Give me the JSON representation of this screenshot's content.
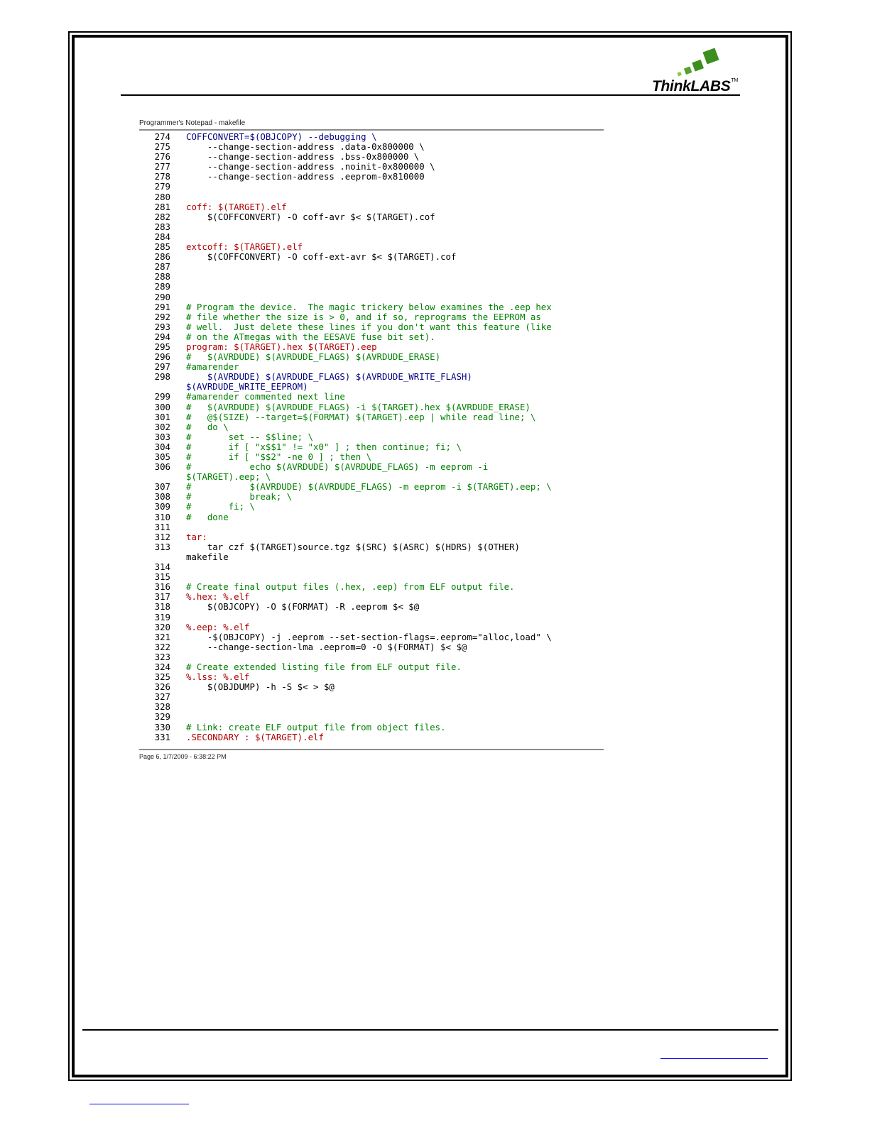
{
  "header": {
    "logo_text": "ThinkLABS",
    "logo_tm": "TM",
    "logo_colors": [
      "#8cc63f",
      "#5aa02c",
      "#3c8f1e"
    ]
  },
  "notepad": {
    "title": "Programmer's Notepad - makefile",
    "footer": "Page 6, 1/7/2009 - 6:38:22 PM"
  },
  "code_lines": [
    {
      "n": "274",
      "t": "COFFCONVERT=$(OBJCOPY) --debugging \\",
      "k": "var"
    },
    {
      "n": "275",
      "t": "    --change-section-address .data-0x800000 \\",
      "k": ""
    },
    {
      "n": "276",
      "t": "    --change-section-address .bss-0x800000 \\",
      "k": ""
    },
    {
      "n": "277",
      "t": "    --change-section-address .noinit-0x800000 \\",
      "k": ""
    },
    {
      "n": "278",
      "t": "    --change-section-address .eeprom-0x810000",
      "k": ""
    },
    {
      "n": "279",
      "t": "",
      "k": ""
    },
    {
      "n": "280",
      "t": "",
      "k": ""
    },
    {
      "n": "281",
      "t": "coff: $(TARGET).elf",
      "k": "tgt"
    },
    {
      "n": "282",
      "t": "    $(COFFCONVERT) -O coff-avr $< $(TARGET).cof",
      "k": ""
    },
    {
      "n": "283",
      "t": "",
      "k": ""
    },
    {
      "n": "284",
      "t": "",
      "k": ""
    },
    {
      "n": "285",
      "t": "extcoff: $(TARGET).elf",
      "k": "tgt"
    },
    {
      "n": "286",
      "t": "    $(COFFCONVERT) -O coff-ext-avr $< $(TARGET).cof",
      "k": ""
    },
    {
      "n": "287",
      "t": "",
      "k": ""
    },
    {
      "n": "288",
      "t": "",
      "k": ""
    },
    {
      "n": "289",
      "t": "",
      "k": ""
    },
    {
      "n": "290",
      "t": "",
      "k": ""
    },
    {
      "n": "291",
      "t": "# Program the device.  The magic trickery below examines the .eep hex",
      "k": "cmt"
    },
    {
      "n": "292",
      "t": "# file whether the size is > 0, and if so, reprograms the EEPROM as",
      "k": "cmt"
    },
    {
      "n": "293",
      "t": "# well.  Just delete these lines if you don't want this feature (like",
      "k": "cmt"
    },
    {
      "n": "294",
      "t": "# on the ATmegas with the EESAVE fuse bit set).",
      "k": "cmt"
    },
    {
      "n": "295",
      "t": "program: $(TARGET).hex $(TARGET).eep",
      "k": "tgt"
    },
    {
      "n": "296",
      "t": "#   $(AVRDUDE) $(AVRDUDE_FLAGS) $(AVRDUDE_ERASE)",
      "k": "cmt"
    },
    {
      "n": "297",
      "t": "#amarender",
      "k": "cmt"
    },
    {
      "n": "298",
      "t": "    $(AVRDUDE) $(AVRDUDE_FLAGS) $(AVRDUDE_WRITE_FLASH)",
      "k": "var"
    },
    {
      "n": "",
      "t": "$(AVRDUDE_WRITE_EEPROM)",
      "k": "var"
    },
    {
      "n": "299",
      "t": "#amarender commented next line",
      "k": "cmt"
    },
    {
      "n": "300",
      "t": "#   $(AVRDUDE) $(AVRDUDE_FLAGS) -i $(TARGET).hex $(AVRDUDE_ERASE)",
      "k": "cmt"
    },
    {
      "n": "301",
      "t": "#   @$(SIZE) --target=$(FORMAT) $(TARGET).eep | while read line; \\",
      "k": "cmt"
    },
    {
      "n": "302",
      "t": "#   do \\",
      "k": "cmt"
    },
    {
      "n": "303",
      "t": "#       set -- $$line; \\",
      "k": "cmt"
    },
    {
      "n": "304",
      "t": "#       if [ \"x$$1\" != \"x0\" ] ; then continue; fi; \\",
      "k": "cmt"
    },
    {
      "n": "305",
      "t": "#       if [ \"$$2\" -ne 0 ] ; then \\",
      "k": "cmt"
    },
    {
      "n": "306",
      "t": "#           echo $(AVRDUDE) $(AVRDUDE_FLAGS) -m eeprom -i",
      "k": "cmt"
    },
    {
      "n": "",
      "t": "$(TARGET).eep; \\",
      "k": "cmt"
    },
    {
      "n": "307",
      "t": "#           $(AVRDUDE) $(AVRDUDE_FLAGS) -m eeprom -i $(TARGET).eep; \\",
      "k": "cmt"
    },
    {
      "n": "308",
      "t": "#           break; \\",
      "k": "cmt"
    },
    {
      "n": "309",
      "t": "#       fi; \\",
      "k": "cmt"
    },
    {
      "n": "310",
      "t": "#   done",
      "k": "cmt"
    },
    {
      "n": "311",
      "t": "",
      "k": ""
    },
    {
      "n": "312",
      "t": "tar:",
      "k": "tgt"
    },
    {
      "n": "313",
      "t": "    tar czf $(TARGET)source.tgz $(SRC) $(ASRC) $(HDRS) $(OTHER)",
      "k": ""
    },
    {
      "n": "",
      "t": "makefile",
      "k": ""
    },
    {
      "n": "314",
      "t": "",
      "k": ""
    },
    {
      "n": "315",
      "t": "",
      "k": ""
    },
    {
      "n": "316",
      "t": "# Create final output files (.hex, .eep) from ELF output file.",
      "k": "cmt"
    },
    {
      "n": "317",
      "t": "%.hex: %.elf",
      "k": "tgt"
    },
    {
      "n": "318",
      "t": "    $(OBJCOPY) -O $(FORMAT) -R .eeprom $< $@",
      "k": ""
    },
    {
      "n": "319",
      "t": "",
      "k": ""
    },
    {
      "n": "320",
      "t": "%.eep: %.elf",
      "k": "tgt"
    },
    {
      "n": "321",
      "t": "    -$(OBJCOPY) -j .eeprom --set-section-flags=.eeprom=\"alloc,load\" \\",
      "k": ""
    },
    {
      "n": "322",
      "t": "    --change-section-lma .eeprom=0 -O $(FORMAT) $< $@",
      "k": ""
    },
    {
      "n": "323",
      "t": "",
      "k": ""
    },
    {
      "n": "324",
      "t": "# Create extended listing file from ELF output file.",
      "k": "cmt"
    },
    {
      "n": "325",
      "t": "%.lss: %.elf",
      "k": "tgt"
    },
    {
      "n": "326",
      "t": "    $(OBJDUMP) -h -S $< > $@",
      "k": ""
    },
    {
      "n": "327",
      "t": "",
      "k": ""
    },
    {
      "n": "328",
      "t": "",
      "k": ""
    },
    {
      "n": "329",
      "t": "",
      "k": ""
    },
    {
      "n": "330",
      "t": "# Link: create ELF output file from object files.",
      "k": "cmt"
    },
    {
      "n": "331",
      "t": ".SECONDARY : $(TARGET).elf",
      "k": "tgt"
    }
  ]
}
